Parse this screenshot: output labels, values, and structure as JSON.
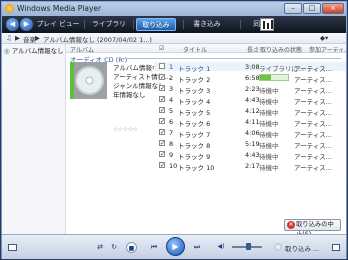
{
  "window": {
    "title": "Windows Media Player",
    "minimize": "–",
    "maximize": "□",
    "close": "×"
  },
  "nav": {
    "tabs": [
      "プレイ ビュー",
      "ライブラリ",
      "取り込み",
      "書き込み",
      "同期"
    ],
    "active_tab": "取り込み"
  },
  "address": {
    "root": "音楽",
    "sep": "▶",
    "album": "アルバム情報なし (2007/04/02 1...)"
  },
  "left_pane": {
    "item": "アルバム情報なし"
  },
  "columns": [
    "アルバム",
    "タイトル",
    "長さ",
    "取り込みの状態",
    "参加アーティ..."
  ],
  "group_header": "オーディオ CD (R:)",
  "album_meta": [
    "アルバム情報な...",
    "アーティスト情報...",
    "ジャンル情報なし",
    "年情報なし"
  ],
  "rating": "☆☆☆☆☆",
  "tracks": [
    {
      "num": "1",
      "title": "トラック 1",
      "length": "3:08",
      "status": "ライブラリに...",
      "artist": "アーティス...",
      "checked": false,
      "progress": 1.0
    },
    {
      "num": "2",
      "title": "トラック 2",
      "length": "6:58",
      "status": "",
      "artist": "アーティス...",
      "checked": true,
      "progress": 0.4
    },
    {
      "num": "3",
      "title": "トラック 3",
      "length": "2:23",
      "status": "待機中",
      "artist": "アーティス...",
      "checked": true
    },
    {
      "num": "4",
      "title": "トラック 4",
      "length": "4:43",
      "status": "待機中",
      "artist": "アーティス...",
      "checked": true
    },
    {
      "num": "5",
      "title": "トラック 5",
      "length": "4:12",
      "status": "待機中",
      "artist": "アーティス...",
      "checked": true
    },
    {
      "num": "6",
      "title": "トラック 6",
      "length": "4:11",
      "status": "待機中",
      "artist": "アーティス...",
      "checked": true
    },
    {
      "num": "7",
      "title": "トラック 7",
      "length": "4:06",
      "status": "待機中",
      "artist": "アーティス...",
      "checked": true
    },
    {
      "num": "8",
      "title": "トラック 8",
      "length": "5:19",
      "status": "待機中",
      "artist": "アーティス...",
      "checked": true
    },
    {
      "num": "9",
      "title": "トラック 9",
      "length": "4:43",
      "status": "待機中",
      "artist": "アーティス...",
      "checked": true
    },
    {
      "num": "10",
      "title": "トラック 10",
      "length": "2:17",
      "status": "待機中",
      "artist": "アーティス...",
      "checked": true
    }
  ],
  "stop_button": "取り込みの中止(S)",
  "player": {
    "shuffle": "⇄",
    "repeat": "↻",
    "stop": "■",
    "prev": "⏮",
    "play": "▶",
    "next": "⏭",
    "mute": "◀)",
    "rip_label": "取り込み ..."
  },
  "colors": {
    "accent": "#1f5ba9",
    "progress": "#6cc24a"
  }
}
